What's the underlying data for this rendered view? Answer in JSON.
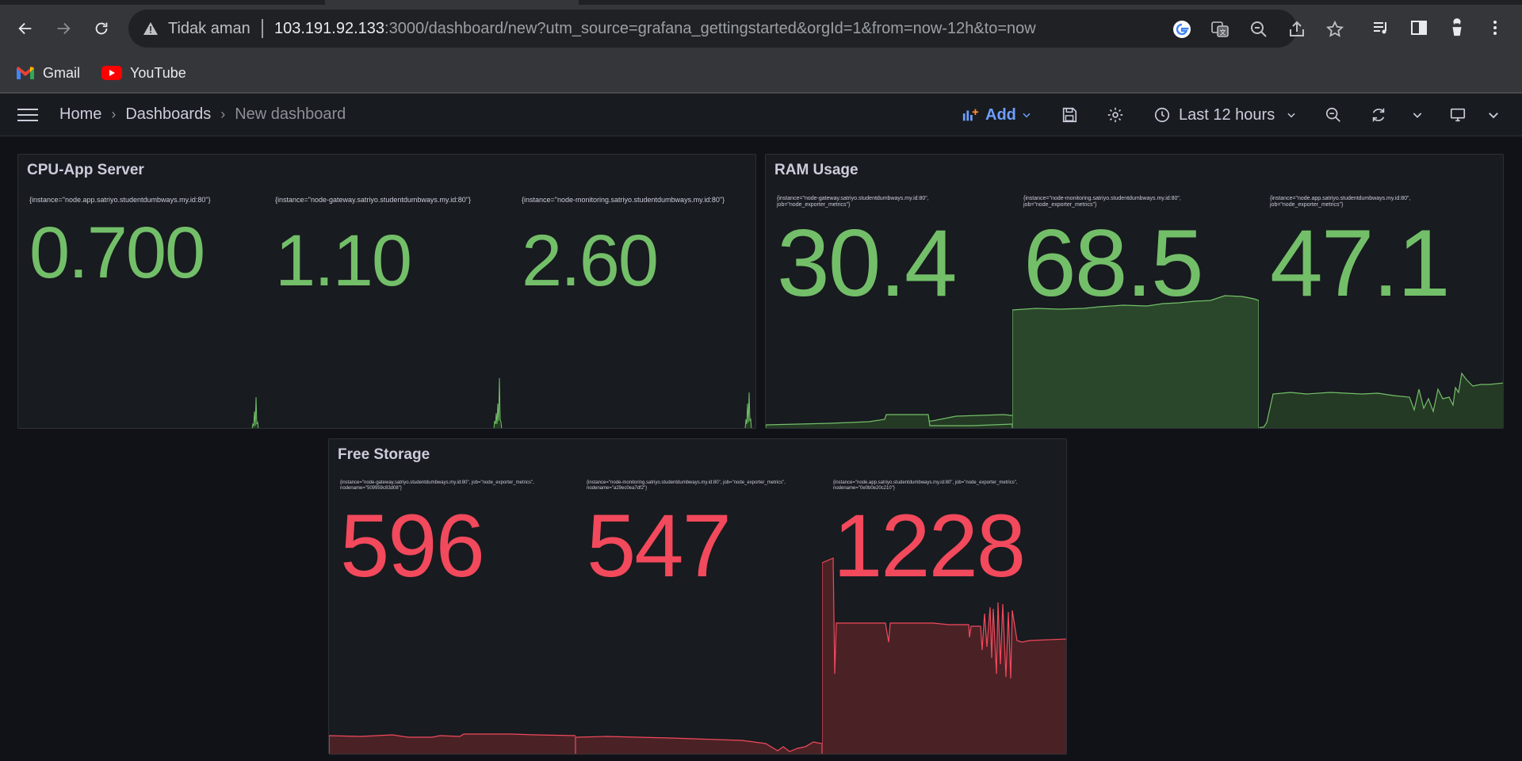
{
  "browser": {
    "not_secure_label": "Tidak aman",
    "url_host": "103.191.92.133",
    "url_rest": ":3000/dashboard/new?utm_source=grafana_gettingstarted&orgId=1&from=now-12h&to=now",
    "bookmarks": [
      {
        "label": "Gmail",
        "icon": "gmail-icon"
      },
      {
        "label": "YouTube",
        "icon": "youtube-icon"
      }
    ]
  },
  "grafana": {
    "breadcrumb": [
      "Home",
      "Dashboards",
      "New dashboard"
    ],
    "add_label": "Add",
    "time_range": "Last 12 hours"
  },
  "colors": {
    "green": "#73bf69",
    "red": "#f2495c",
    "accent": "#6e9fff"
  },
  "panels": {
    "cpu": {
      "title": "CPU-App Server",
      "stats": [
        {
          "label": "{instance=\"node.app.satriyo.studentdumbways.my.id:80\"}",
          "value": "0.700"
        },
        {
          "label": "{instance=\"node-gateway.satriyo.studentdumbways.my.id:80\"}",
          "value": "1.10"
        },
        {
          "label": "{instance=\"node-monitoring.satriyo.studentdumbways.my.id:80\"}",
          "value": "2.60"
        }
      ]
    },
    "ram": {
      "title": "RAM Usage",
      "stats": [
        {
          "label": "{instance=\"node-gateway.satriyo.studentdumbways.my.id:80\", job=\"node_exporter_metrics\"}",
          "value": "30.4"
        },
        {
          "label": "{instance=\"node-monitoring.satriyo.studentdumbways.my.id:80\", job=\"node_exporter_metrics\"}",
          "value": "68.5"
        },
        {
          "label": "{instance=\"node.app.satriyo.studentdumbways.my.id:80\", job=\"node_exporter_metrics\"}",
          "value": "47.1"
        }
      ]
    },
    "storage": {
      "title": "Free Storage",
      "stats": [
        {
          "label": "{instance=\"node-gateway.satriyo.studentdumbways.my.id:80\", job=\"node_exporter_metrics\", nodename=\"509959c83d08\"}",
          "value": "596"
        },
        {
          "label": "{instance=\"node-monitoring.satriyo.studentdumbways.my.id:80\", job=\"node_exporter_metrics\", nodename=\"a29ec0ea7df2\"}",
          "value": "547"
        },
        {
          "label": "{instance=\"node.app.satriyo.studentdumbways.my.id:80\", job=\"node_exporter_metrics\", nodename=\"0e0b0e20c210\"}",
          "value": "1228"
        }
      ]
    }
  }
}
